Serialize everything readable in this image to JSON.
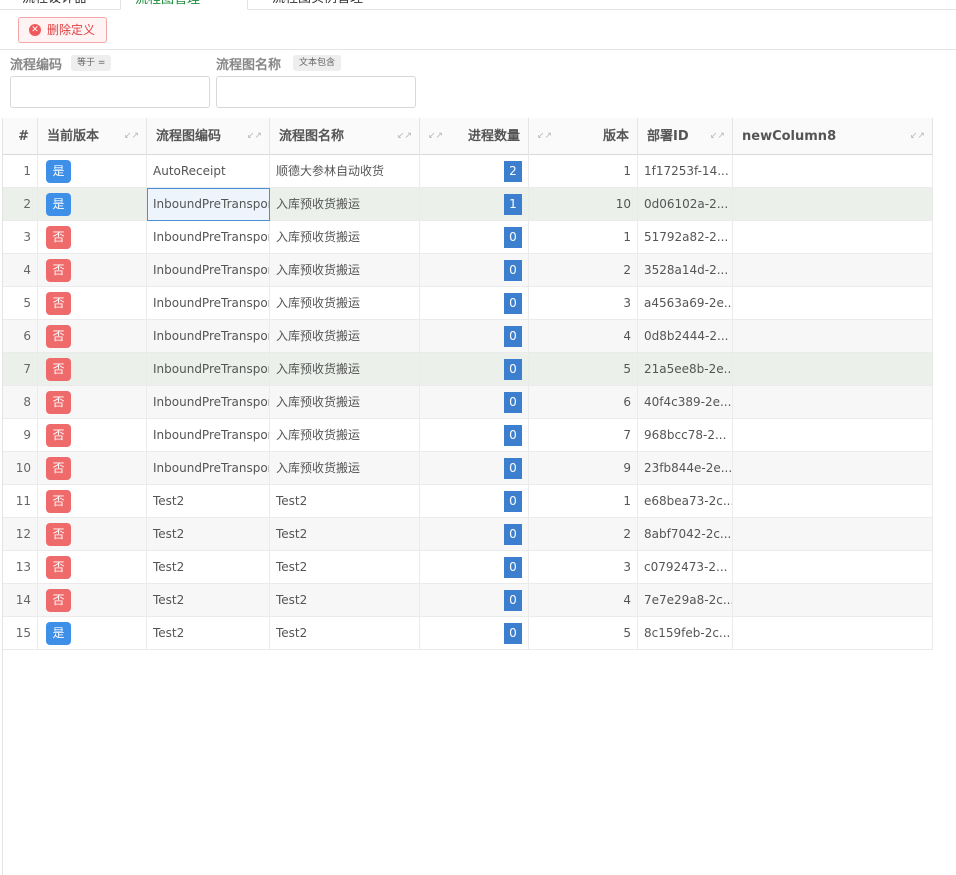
{
  "tabs": [
    {
      "label": "流程设计器"
    },
    {
      "label": "流程图管理"
    },
    {
      "label": "流程图实例管理"
    }
  ],
  "toolbar": {
    "delete_label": "删除定义"
  },
  "filters": [
    {
      "label": "流程编码",
      "operator": "等于 =",
      "value": ""
    },
    {
      "label": "流程图名称",
      "operator": "文本包含",
      "value": ""
    }
  ],
  "table": {
    "columns": [
      "#",
      "当前版本",
      "流程图编码",
      "流程图名称",
      "进程数量",
      "版本",
      "部署ID",
      "newColumn8"
    ],
    "rows": [
      {
        "n": "1",
        "current": "是",
        "code": "AutoReceipt",
        "name": "顺德大参林自动收货",
        "count": "2",
        "version": "1",
        "deploy": "1f17253f-14..."
      },
      {
        "n": "2",
        "current": "是",
        "code": "InboundPreTransport",
        "name": "入库预收货搬运",
        "count": "1",
        "version": "10",
        "deploy": "0d06102a-2..."
      },
      {
        "n": "3",
        "current": "否",
        "code": "InboundPreTransport",
        "name": "入库预收货搬运",
        "count": "0",
        "version": "1",
        "deploy": "51792a82-2..."
      },
      {
        "n": "4",
        "current": "否",
        "code": "InboundPreTransport",
        "name": "入库预收货搬运",
        "count": "0",
        "version": "2",
        "deploy": "3528a14d-2..."
      },
      {
        "n": "5",
        "current": "否",
        "code": "InboundPreTransport",
        "name": "入库预收货搬运",
        "count": "0",
        "version": "3",
        "deploy": "a4563a69-2e..."
      },
      {
        "n": "6",
        "current": "否",
        "code": "InboundPreTransport",
        "name": "入库预收货搬运",
        "count": "0",
        "version": "4",
        "deploy": "0d8b2444-2..."
      },
      {
        "n": "7",
        "current": "否",
        "code": "InboundPreTransport",
        "name": "入库预收货搬运",
        "count": "0",
        "version": "5",
        "deploy": "21a5ee8b-2e..."
      },
      {
        "n": "8",
        "current": "否",
        "code": "InboundPreTransport",
        "name": "入库预收货搬运",
        "count": "0",
        "version": "6",
        "deploy": "40f4c389-2e..."
      },
      {
        "n": "9",
        "current": "否",
        "code": "InboundPreTransport",
        "name": "入库预收货搬运",
        "count": "0",
        "version": "7",
        "deploy": "968bcc78-2..."
      },
      {
        "n": "10",
        "current": "否",
        "code": "InboundPreTransport",
        "name": "入库预收货搬运",
        "count": "0",
        "version": "9",
        "deploy": "23fb844e-2e..."
      },
      {
        "n": "11",
        "current": "否",
        "code": "Test2",
        "name": "Test2",
        "count": "0",
        "version": "1",
        "deploy": "e68bea73-2c..."
      },
      {
        "n": "12",
        "current": "否",
        "code": "Test2",
        "name": "Test2",
        "count": "0",
        "version": "2",
        "deploy": "8abf7042-2c..."
      },
      {
        "n": "13",
        "current": "否",
        "code": "Test2",
        "name": "Test2",
        "count": "0",
        "version": "3",
        "deploy": "c0792473-2..."
      },
      {
        "n": "14",
        "current": "否",
        "code": "Test2",
        "name": "Test2",
        "count": "0",
        "version": "4",
        "deploy": "7e7e29a8-2c..."
      },
      {
        "n": "15",
        "current": "是",
        "code": "Test2",
        "name": "Test2",
        "count": "0",
        "version": "5",
        "deploy": "8c159feb-2c..."
      }
    ],
    "highlighted_rows": [
      2,
      7
    ],
    "selected_cell": {
      "row": 2,
      "column": "流程图编码"
    }
  },
  "colors": {
    "yes_badge": "#3d8fe8",
    "no_badge": "#ef6b6b",
    "count_box": "#3d7fcf",
    "active_tab": "#1d8b3a"
  }
}
